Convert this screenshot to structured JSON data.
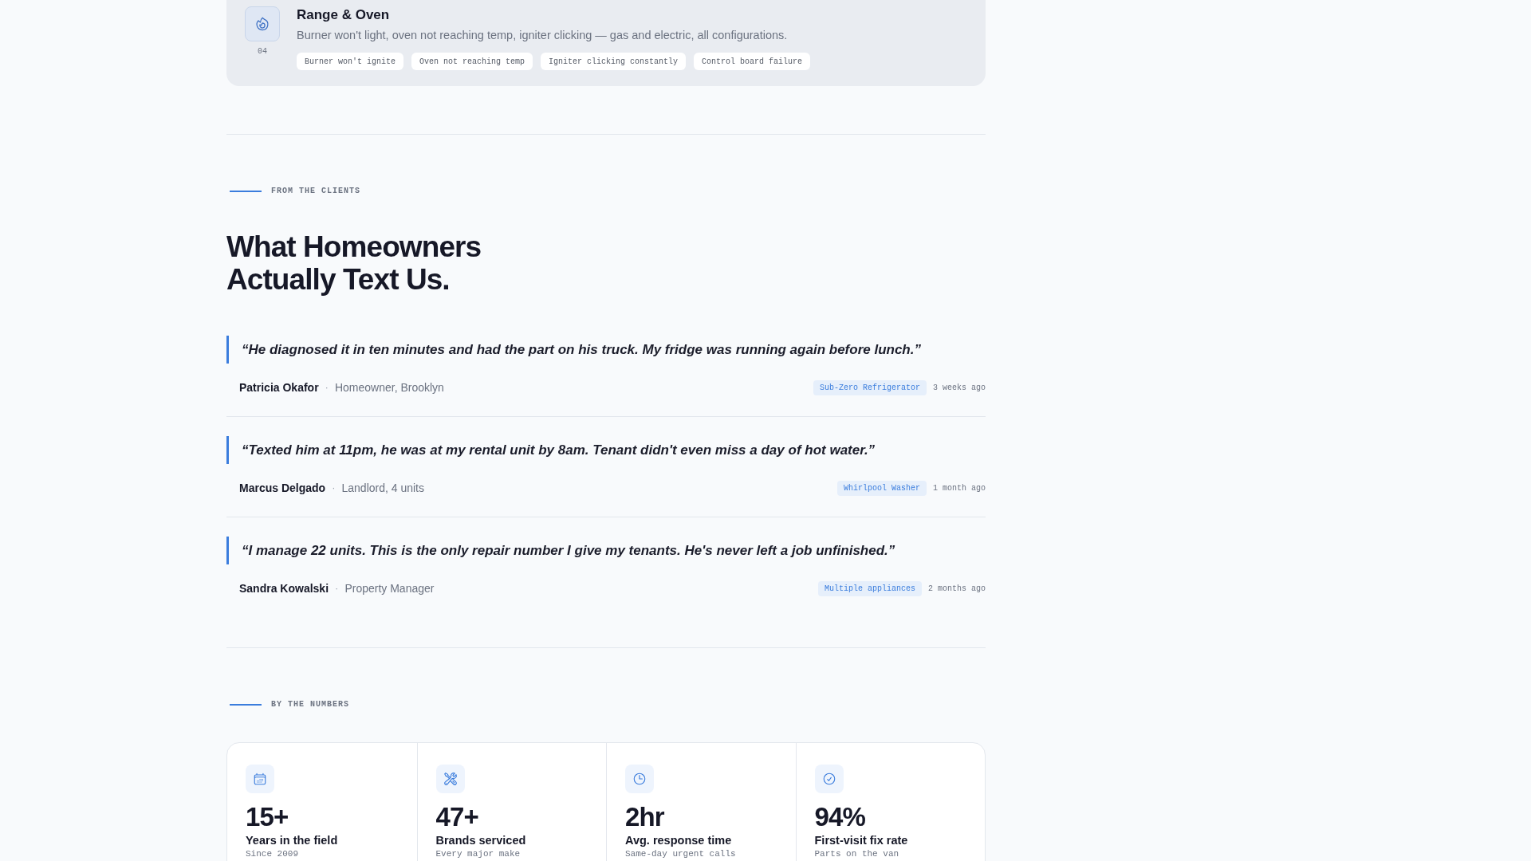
{
  "service_card": {
    "number": "04",
    "title": "Range & Oven",
    "description": "Burner won't light, oven not reaching temp, igniter clicking — gas and electric, all configurations.",
    "tags": [
      "Burner won't ignite",
      "Oven not reaching temp",
      "Igniter clicking constantly",
      "Control board failure"
    ]
  },
  "testimonials": {
    "eyebrow": "FROM THE CLIENTS",
    "heading": "What Homeowners Actually Text Us.",
    "items": [
      {
        "quote": "“He diagnosed it in ten minutes and had the part on his truck. My fridge was running again before lunch.”",
        "name": "Patricia Okafor",
        "separator": "·",
        "role": "Homeowner, Brooklyn",
        "appliance": "Sub-Zero Refrigerator",
        "time": "3 weeks ago"
      },
      {
        "quote": "“Texted him at 11pm, he was at my rental unit by 8am. Tenant didn't even miss a day of hot water.”",
        "name": "Marcus Delgado",
        "separator": "·",
        "role": "Landlord, 4 units",
        "appliance": "Whirlpool Washer",
        "time": "1 month ago"
      },
      {
        "quote": "“I manage 22 units. This is the only repair number I give my tenants. He's never left a job unfinished.”",
        "name": "Sandra Kowalski",
        "separator": "·",
        "role": "Property Manager",
        "appliance": "Multiple appliances",
        "time": "2 months ago"
      }
    ]
  },
  "stats": {
    "eyebrow": "BY THE NUMBERS",
    "items": [
      {
        "value": "15+",
        "label": "Years in the field",
        "note": "Since 2009"
      },
      {
        "value": "47+",
        "label": "Brands serviced",
        "note": "Every major make"
      },
      {
        "value": "2hr",
        "label": "Avg. response time",
        "note": "Same-day urgent calls"
      },
      {
        "value": "94%",
        "label": "First-visit fix rate",
        "note": "Parts on the van"
      }
    ]
  }
}
